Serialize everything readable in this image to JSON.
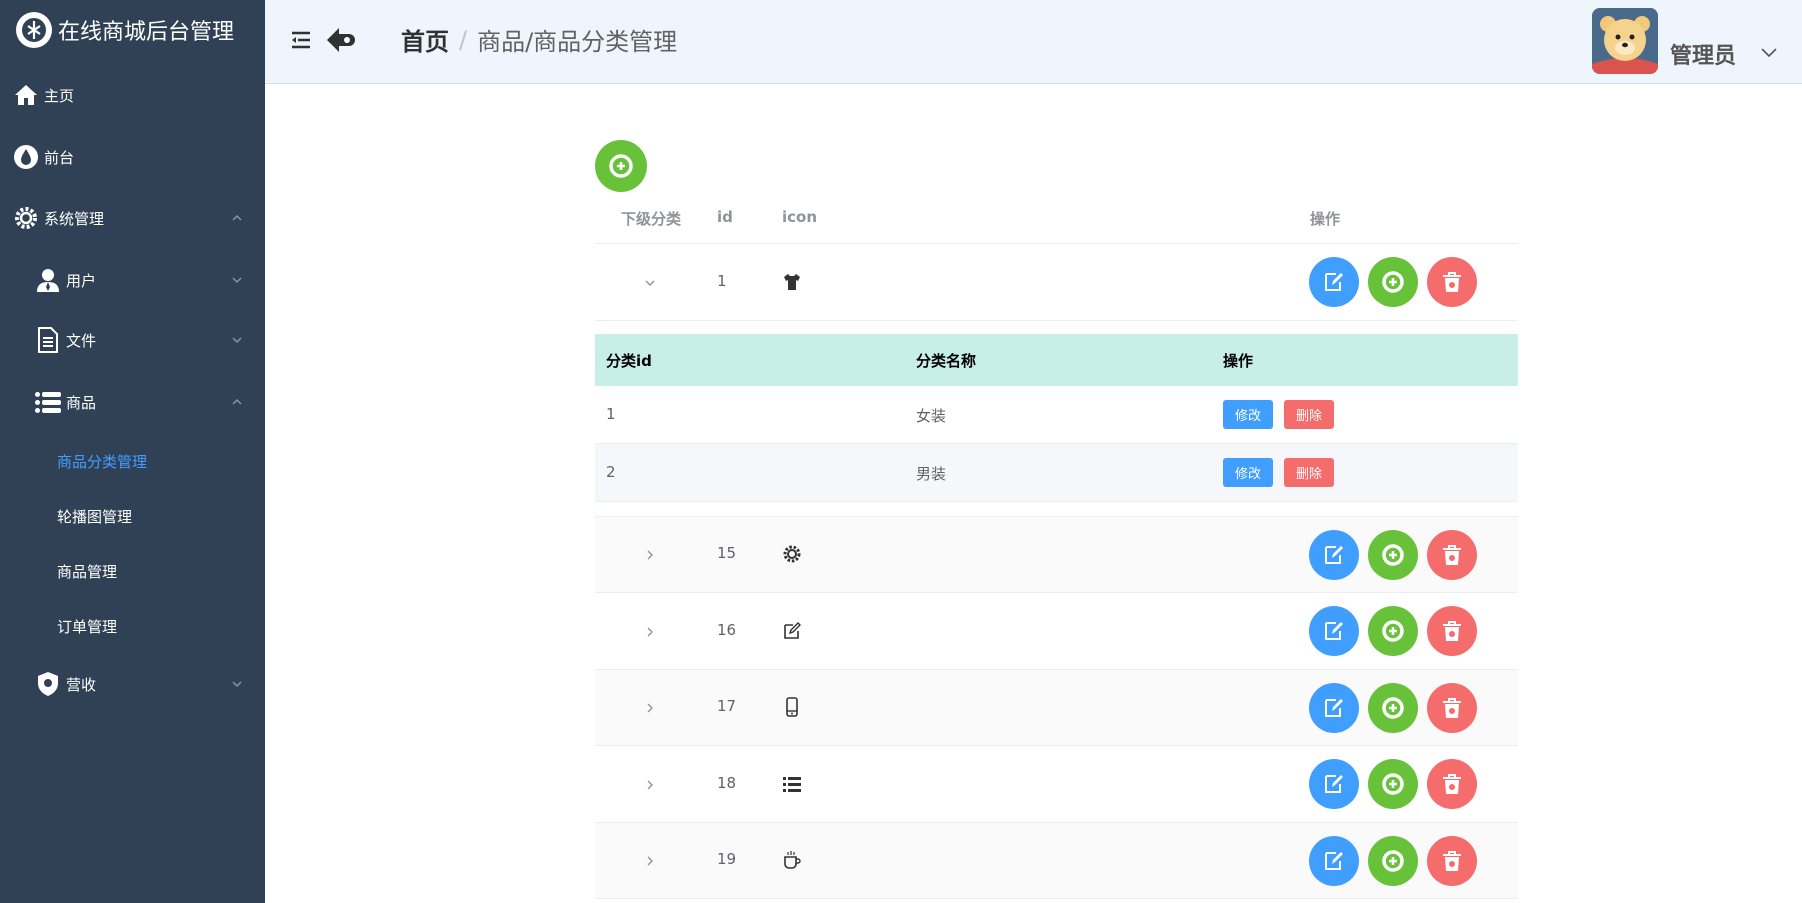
{
  "app": {
    "title": "在线商城后台管理"
  },
  "sidebar": {
    "items": [
      {
        "label": "主页",
        "icon": "home-icon"
      },
      {
        "label": "前台",
        "icon": "drop-icon"
      },
      {
        "label": "系统管理",
        "icon": "gear-icon"
      },
      {
        "label": "用户",
        "icon": "user-icon"
      },
      {
        "label": "文件",
        "icon": "document-icon"
      },
      {
        "label": "商品",
        "icon": "list-icon"
      },
      {
        "label": "营收",
        "icon": "shield-icon"
      }
    ],
    "goods_sub": [
      "商品分类管理",
      "轮播图管理",
      "商品管理",
      "订单管理"
    ]
  },
  "header": {
    "breadcrumb_home": "首页",
    "breadcrumb_sep": "/",
    "breadcrumb_current": "商品/商品分类管理",
    "user_name": "管理员"
  },
  "table": {
    "headers": {
      "expand": "下级分类",
      "id": "id",
      "icon": "icon",
      "actions": "操作"
    },
    "rows": [
      {
        "id": "1",
        "icon": "shirt-icon"
      },
      {
        "id": "15",
        "icon": "gear-icon"
      },
      {
        "id": "16",
        "icon": "edit-icon"
      },
      {
        "id": "17",
        "icon": "phone-icon"
      },
      {
        "id": "18",
        "icon": "list-icon"
      },
      {
        "id": "19",
        "icon": "cup-icon"
      }
    ]
  },
  "subtable": {
    "headers": {
      "id": "分类id",
      "name": "分类名称",
      "actions": "操作"
    },
    "rows": [
      {
        "id": "1",
        "name": "女装"
      },
      {
        "id": "2",
        "name": "男装"
      }
    ],
    "edit_label": "修改",
    "delete_label": "删除"
  },
  "colors": {
    "sidebar_bg": "#304156",
    "primary": "#409eff",
    "success": "#67c23a",
    "danger": "#f56c6c",
    "active_menu": "#409eff"
  }
}
